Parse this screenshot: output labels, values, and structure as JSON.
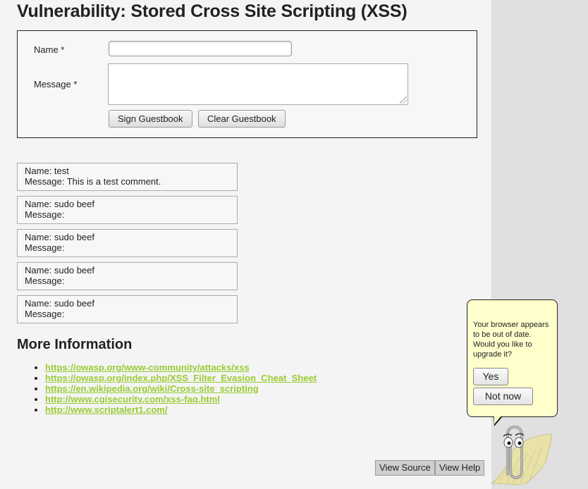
{
  "page": {
    "title": "Vulnerability: Stored Cross Site Scripting (XSS)"
  },
  "form": {
    "name_label": "Name *",
    "message_label": "Message *",
    "name_value": "",
    "message_value": "",
    "sign_button": "Sign Guestbook",
    "clear_button": "Clear Guestbook"
  },
  "guestbook": [
    {
      "name": "Name: test",
      "message": "Message: This is a test comment."
    },
    {
      "name": "Name: sudo beef",
      "message": "Message:"
    },
    {
      "name": "Name: sudo beef",
      "message": "Message:"
    },
    {
      "name": "Name: sudo beef",
      "message": "Message:"
    },
    {
      "name": "Name: sudo beef",
      "message": "Message:"
    }
  ],
  "more_info": {
    "heading": "More Information",
    "links": [
      "https://owasp.org/www-community/attacks/xss",
      "https://owasp.org/index.php/XSS_Filter_Evasion_Cheat_Sheet",
      "https://en.wikipedia.org/wiki/Cross-site_scripting",
      "http://www.cgisecurity.com/xss-faq.html",
      "http://www.scriptalert1.com/"
    ]
  },
  "footer": {
    "view_source": "View Source",
    "view_help": "View Help"
  },
  "popup": {
    "text": "Your browser appears to be out of date. Would you like to upgrade it?",
    "yes": "Yes",
    "not_now": "Not now"
  },
  "colors": {
    "link": "#99cc33",
    "bubble": "#ffffcc",
    "right_strip": "#e0e0e0"
  }
}
